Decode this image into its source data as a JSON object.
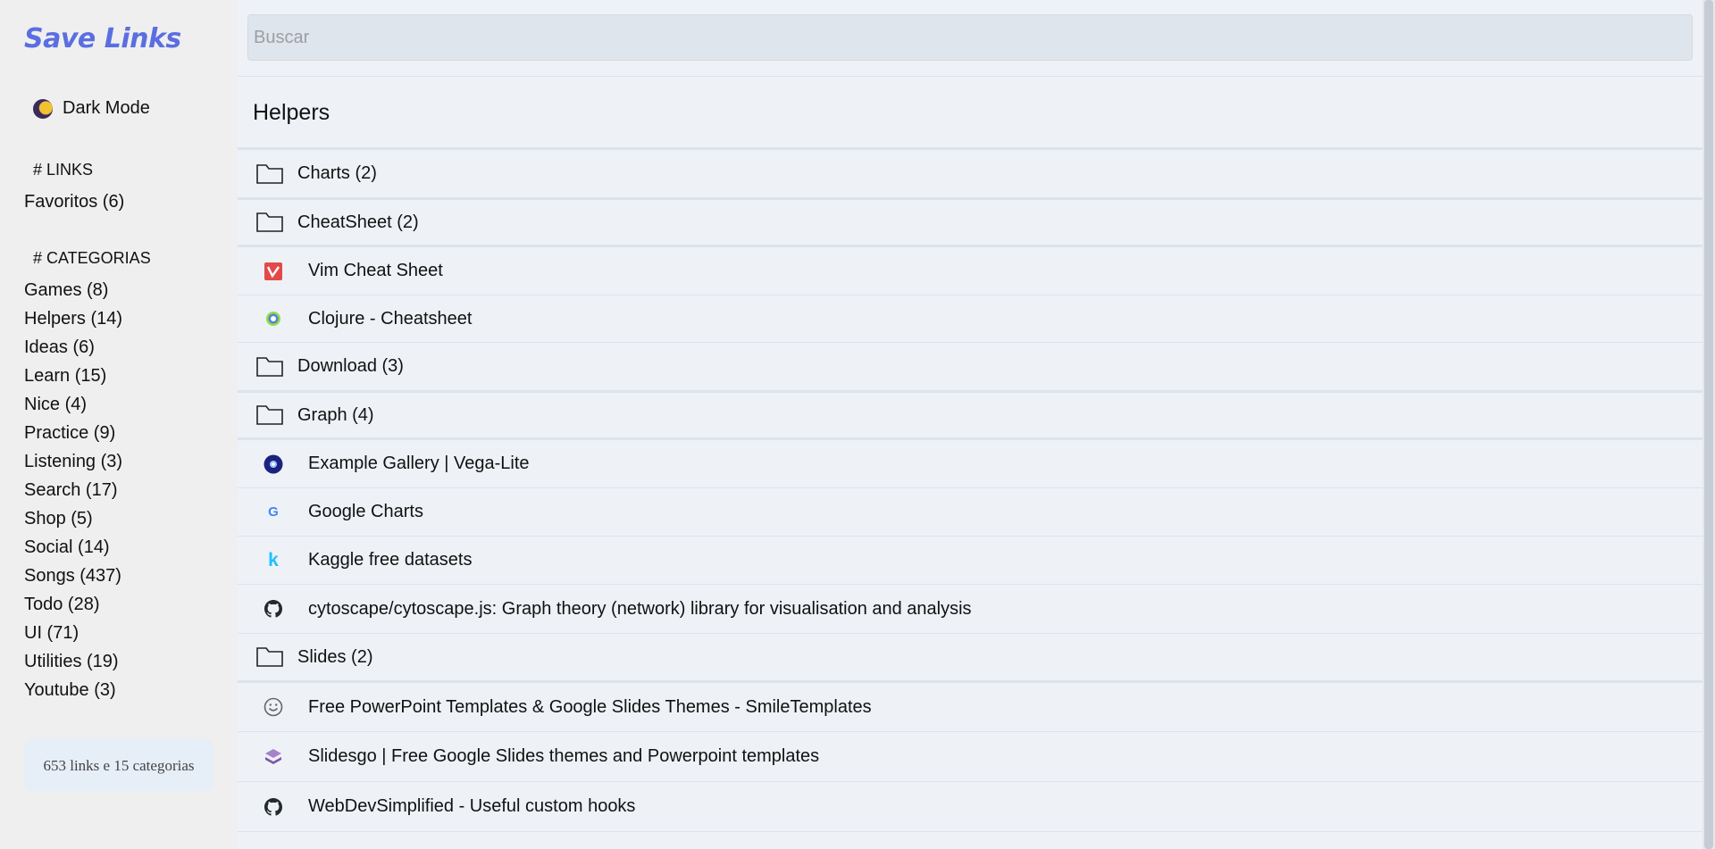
{
  "sidebar": {
    "brand": "Save Links",
    "dark_mode_label": "Dark Mode",
    "links_header": "# LINKS",
    "links": [
      {
        "label": "Favoritos (6)"
      }
    ],
    "categories_header": "# CATEGORIAS",
    "categories": [
      {
        "label": "Games (8)"
      },
      {
        "label": "Helpers (14)"
      },
      {
        "label": "Ideas (6)"
      },
      {
        "label": "Learn (15)"
      },
      {
        "label": "Nice (4)"
      },
      {
        "label": "Practice (9)"
      },
      {
        "label": "Listening (3)"
      },
      {
        "label": "Search (17)"
      },
      {
        "label": "Shop (5)"
      },
      {
        "label": "Social (14)"
      },
      {
        "label": "Songs (437)"
      },
      {
        "label": "Todo (28)"
      },
      {
        "label": "UI (71)"
      },
      {
        "label": "Utilities (19)"
      },
      {
        "label": "Youtube (3)"
      }
    ],
    "summary": "653 links e 15 categorias"
  },
  "search": {
    "placeholder": "Buscar",
    "value": ""
  },
  "main": {
    "title": "Helpers",
    "rows": [
      {
        "type": "folder",
        "label": "Charts (2)",
        "icon": "folder-icon"
      },
      {
        "type": "folder",
        "label": "CheatSheet (2)",
        "icon": "folder-icon"
      },
      {
        "type": "link",
        "label": "Vim Cheat Sheet",
        "icon": "vim-favicon"
      },
      {
        "type": "link",
        "label": "Clojure - Cheatsheet",
        "icon": "clojure-favicon"
      },
      {
        "type": "folder",
        "label": "Download (3)",
        "icon": "folder-icon"
      },
      {
        "type": "folder",
        "label": "Graph (4)",
        "icon": "folder-icon"
      },
      {
        "type": "link",
        "label": "Example Gallery | Vega-Lite",
        "icon": "vega-favicon"
      },
      {
        "type": "link",
        "label": "Google Charts",
        "icon": "google-favicon"
      },
      {
        "type": "link",
        "label": "Kaggle free datasets",
        "icon": "kaggle-favicon"
      },
      {
        "type": "link",
        "label": "cytoscape/cytoscape.js: Graph theory (network) library for visualisation and analysis",
        "icon": "github-favicon"
      },
      {
        "type": "folder",
        "label": "Slides (2)",
        "icon": "folder-icon"
      },
      {
        "type": "link",
        "label": "Free PowerPoint Templates & Google Slides Themes - SmileTemplates",
        "icon": "smile-favicon"
      },
      {
        "type": "link",
        "label": "Slidesgo | Free Google Slides themes and Powerpoint templates",
        "icon": "slidesgo-favicon"
      },
      {
        "type": "link",
        "label": "WebDevSimplified - Useful custom hooks",
        "icon": "github-favicon"
      }
    ]
  },
  "colors": {
    "brand": "#5b6ee1",
    "sidebar_bg": "#efefef",
    "main_bg": "#eef2f7",
    "search_bg": "#dfe5ec"
  }
}
